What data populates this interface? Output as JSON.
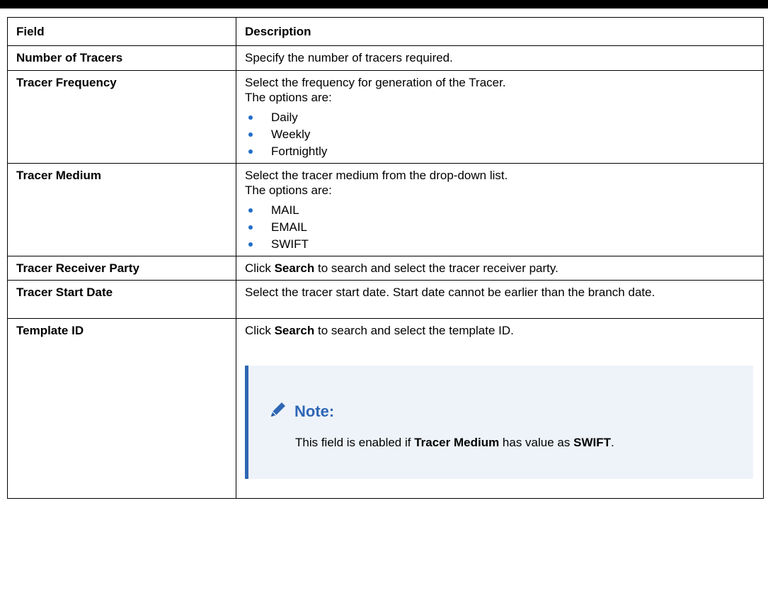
{
  "table": {
    "headers": {
      "field": "Field",
      "description": "Description"
    },
    "rows": {
      "number_of_tracers": {
        "field": "Number of Tracers",
        "description": "Specify the number of tracers required."
      },
      "tracer_frequency": {
        "field": "Tracer Frequency",
        "line1": "Select the frequency for generation of the Tracer.",
        "line2": "The options are:",
        "options": [
          "Daily",
          "Weekly",
          "Fortnightly"
        ]
      },
      "tracer_medium": {
        "field": "Tracer Medium",
        "line1": "Select the tracer medium from the drop-down list.",
        "line2": "The options are:",
        "options": [
          "MAIL",
          "EMAIL",
          "SWIFT"
        ]
      },
      "tracer_receiver_party": {
        "field": "Tracer Receiver Party",
        "pre": "Click ",
        "bold": "Search",
        "post": " to search and select the tracer receiver party."
      },
      "tracer_start_date": {
        "field": "Tracer Start Date",
        "description": "Select the tracer start date. Start date cannot be earlier than the branch date."
      },
      "template_id": {
        "field": "Template ID",
        "pre": "Click ",
        "bold": "Search",
        "post": " to search and select the template ID.",
        "note": {
          "title": "Note:",
          "pre": "This field is enabled if ",
          "bold1": "Tracer Medium",
          "mid": " has value as ",
          "bold2": "SWIFT",
          "post": "."
        }
      }
    }
  },
  "colors": {
    "accent": "#2e66b5",
    "bullet": "#1f6ec9",
    "note_bg": "#eef3f9"
  },
  "icons": {
    "note": "pencil-icon",
    "bullet": "bullet-icon"
  }
}
